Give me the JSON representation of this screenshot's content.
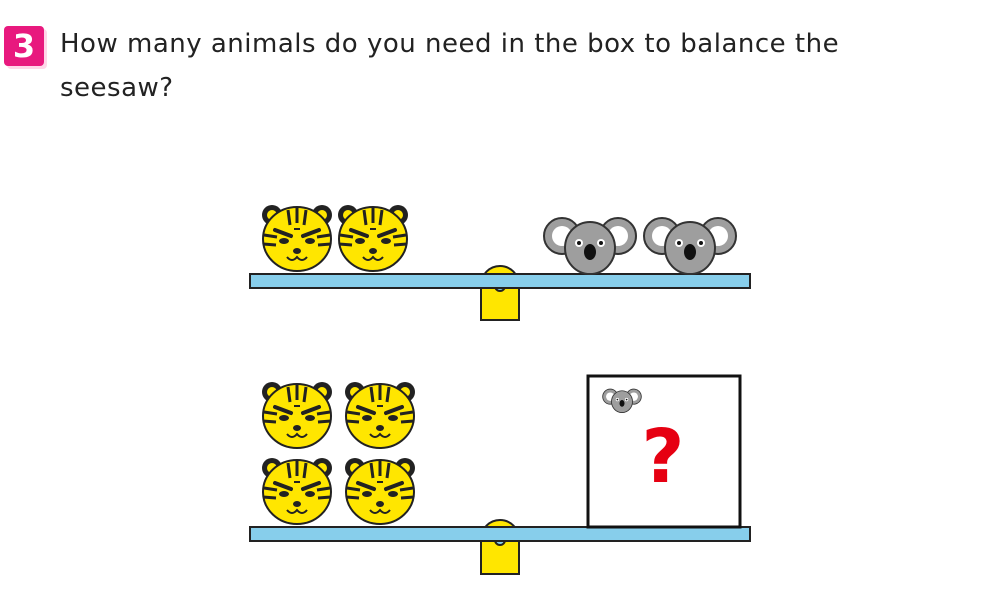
{
  "question": {
    "number": "3",
    "text": "How many animals do you need in the box to balance the seesaw?"
  },
  "seesaw_top": {
    "left_side": [
      {
        "animal": "tiger"
      },
      {
        "animal": "tiger"
      }
    ],
    "right_side": [
      {
        "animal": "koala"
      },
      {
        "animal": "koala"
      }
    ]
  },
  "seesaw_bottom": {
    "left_side": [
      {
        "animal": "tiger"
      },
      {
        "animal": "tiger"
      },
      {
        "animal": "tiger"
      },
      {
        "animal": "tiger"
      }
    ],
    "box": {
      "hint_animal": "koala",
      "mark": "?"
    }
  },
  "colors": {
    "beam": "#87ceeb",
    "fulcrum": "#ffe600",
    "tiger": "#ffe600",
    "koala": "#9e9e9e",
    "question_mark": "#e60012",
    "question_badge": "#e8197e"
  }
}
